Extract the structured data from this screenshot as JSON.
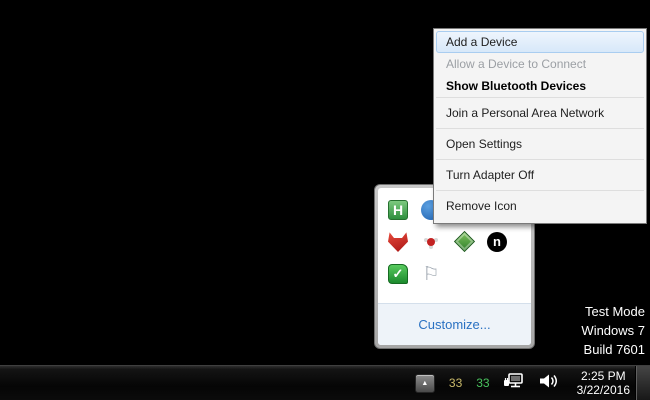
{
  "desktop": {
    "watermark": [
      "Test Mode",
      "Windows 7",
      "Build 7601"
    ]
  },
  "context_menu": {
    "items": [
      {
        "label": "Add a Device",
        "state": "highlighted",
        "separator_after": false,
        "tall": false
      },
      {
        "label": "Allow a Device to Connect",
        "state": "disabled",
        "separator_after": false,
        "tall": false
      },
      {
        "label": "Show Bluetooth Devices",
        "state": "default-bold",
        "separator_after": true,
        "tall": false
      },
      {
        "label": "Join a Personal Area Network",
        "state": "normal",
        "separator_after": true,
        "tall": true
      },
      {
        "label": "Open Settings",
        "state": "normal",
        "separator_after": true,
        "tall": true
      },
      {
        "label": "Turn Adapter Off",
        "state": "normal",
        "separator_after": true,
        "tall": true
      },
      {
        "label": "Remove Icon",
        "state": "normal",
        "separator_after": false,
        "tall": true
      }
    ]
  },
  "tray_popup": {
    "customize_label": "Customize...",
    "icon_rows": [
      [
        {
          "name": "green-h-icon",
          "text": "H"
        },
        {
          "name": "blue-badge-icon",
          "text": ""
        },
        {
          "name": "olive-box-icon",
          "text": ""
        },
        {
          "name": "blue-swirl-icon",
          "text": ""
        }
      ],
      [
        {
          "name": "red-fox-icon",
          "text": ""
        },
        {
          "name": "red-fan-icon",
          "text": ""
        },
        {
          "name": "green-diamond-icon",
          "text": ""
        },
        {
          "name": "black-n-icon",
          "text": "n"
        }
      ],
      [
        {
          "name": "green-check-icon",
          "text": "✓"
        },
        {
          "name": "white-flag-icon",
          "text": "⚐"
        }
      ]
    ]
  },
  "taskbar": {
    "show_hidden_icons_glyph": "▲",
    "temp_yellow": "33",
    "temp_green": "33",
    "clock_time": "2:25 PM",
    "clock_date": "3/22/2016"
  },
  "colors": {
    "menu_highlight_fill": "#d7e8f9",
    "menu_highlight_border": "#a9cdf0",
    "customize_link": "#2a71c2",
    "temp_yellow": "#c9b96a",
    "temp_green": "#49c25e",
    "watermark_text": "#ffffff"
  }
}
